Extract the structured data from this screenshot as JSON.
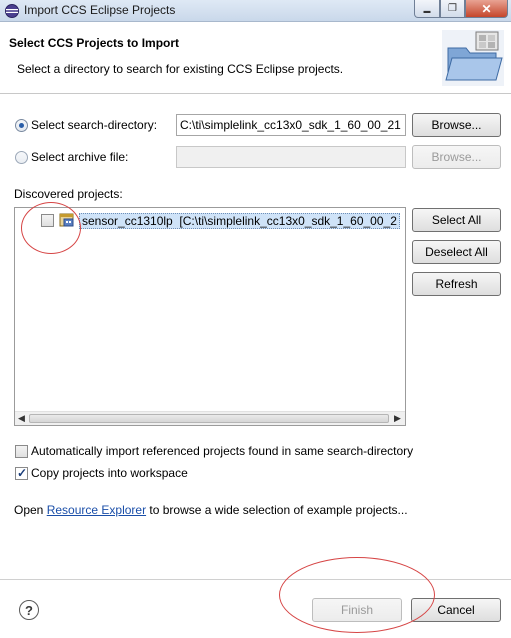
{
  "window": {
    "title": "Import CCS Eclipse Projects",
    "minimize_glyph": "▬",
    "maximize_glyph": "❐",
    "close_glyph": "✕"
  },
  "banner": {
    "heading": "Select CCS Projects to Import",
    "description": "Select a directory to search for existing CCS Eclipse projects."
  },
  "source": {
    "search_dir_label": "Select search-directory:",
    "search_dir_value": "C:\\ti\\simplelink_cc13x0_sdk_1_60_00_21",
    "search_dir_selected": true,
    "archive_label": "Select archive file:",
    "archive_value": "",
    "browse_label": "Browse..."
  },
  "discovered": {
    "label": "Discovered projects:",
    "items": [
      {
        "name": "sensor_cc1310lp",
        "path": "[C:\\ti\\simplelink_cc13x0_sdk_1_60_00_2",
        "checked": false,
        "icon": "ccs-project-icon"
      }
    ],
    "select_all_label": "Select All",
    "deselect_all_label": "Deselect All",
    "refresh_label": "Refresh"
  },
  "options": {
    "auto_import_label": "Automatically import referenced projects found in same search-directory",
    "auto_import_checked": false,
    "copy_label": "Copy projects into workspace",
    "copy_checked": true
  },
  "resource": {
    "prefix": "Open ",
    "link": "Resource Explorer",
    "suffix": " to browse a wide selection of example projects..."
  },
  "footer": {
    "help_glyph": "?",
    "finish_label": "Finish",
    "cancel_label": "Cancel"
  },
  "colors": {
    "annotation_circle": "#d64545",
    "link": "#1a4ea8",
    "selection": "#cfe3f8"
  }
}
